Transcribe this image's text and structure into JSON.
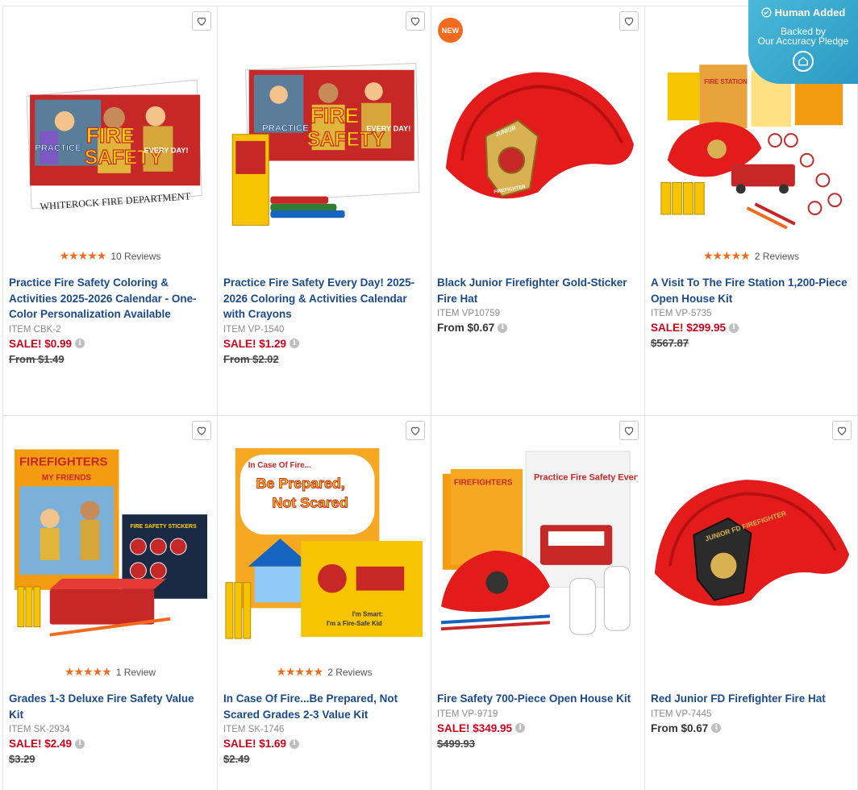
{
  "badge": {
    "title": "Human Added",
    "line1": "Backed by",
    "line2": "Our Accuracy Pledge"
  },
  "new_label": "NEW",
  "products": [
    {
      "title": "Practice Fire Safety Coloring & Activities 2025-2026 Calendar - One-Color Personalization Available",
      "sku": "ITEM CBK-2",
      "sale": "SALE! $0.99",
      "was": "From $1.49",
      "reviews": "10 Reviews"
    },
    {
      "title": "Practice Fire Safety Every Day! 2025-2026 Coloring & Activities Calendar with Crayons",
      "sku": "ITEM VP-1540",
      "sale": "SALE! $1.29",
      "was": "From $2.02"
    },
    {
      "title": "Black Junior Firefighter Gold-Sticker Fire Hat",
      "sku": "ITEM VP10759",
      "from": "From $0.67"
    },
    {
      "title": "A Visit To The Fire Station 1,200-Piece Open House Kit",
      "sku": "ITEM VP-5735",
      "sale": "SALE! $299.95",
      "was": "$567.87",
      "reviews": "2 Reviews"
    },
    {
      "title": "Grades 1-3 Deluxe Fire Safety Value Kit",
      "sku": "ITEM SK-2934",
      "sale": "SALE! $2.49",
      "was": "$3.29",
      "reviews": "1 Review"
    },
    {
      "title": "In Case Of Fire...Be Prepared, Not Scared Grades 2-3 Value Kit",
      "sku": "ITEM SK-1746",
      "sale": "SALE! $1.69",
      "was": "$2.49",
      "reviews": "2 Reviews"
    },
    {
      "title": "Fire Safety 700-Piece Open House Kit",
      "sku": "ITEM VP-9719",
      "sale": "SALE! $349.95",
      "was": "$499.93"
    },
    {
      "title": "Red Junior FD Firefighter Fire Hat",
      "sku": "ITEM VP-7445",
      "from": "From $0.67"
    }
  ],
  "image_text": {
    "calendar_dept": "WHITEROCK FIRE DEPARTMENT",
    "practice": "PRACTICE",
    "fire": "FIRE",
    "safety": "SAFETY",
    "every_day": "EVERY DAY!",
    "junior": "JUNIOR",
    "firefighter": "FIREFIGHTER",
    "fire_station": "FIRE STATION",
    "firefighters": "FIREFIGHTERS",
    "my_friends": "MY FRIENDS",
    "stickers": "FIRE SAFETY STICKERS",
    "in_case": "In Case Of Fire...",
    "be_prepared": "Be Prepared,",
    "not_scared": "Not Scared",
    "im_smart": "I'm Smart:",
    "fire_safe_kid": "I'm a Fire-Safe Kid",
    "practice_every": "Practice Fire Safety Every Day!",
    "jr_fd": "JUNIOR FD FIREFIGHTER"
  },
  "colors": {
    "link": "#1a4a8c",
    "sale": "#d0021b",
    "star": "#f26a1b",
    "badge": "#3aa9d2"
  }
}
